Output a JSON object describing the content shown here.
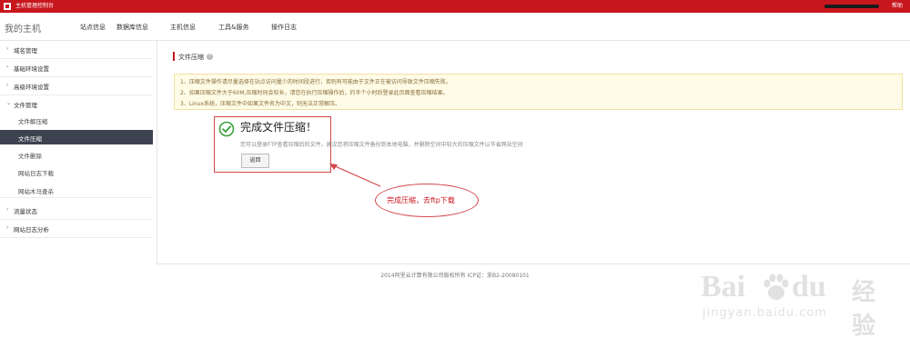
{
  "topbar": {
    "app_title": "主机管理控制台",
    "help_label": "帮助"
  },
  "navbar": {
    "brand": "我的主机",
    "items": [
      "站点信息",
      "数据库信息",
      "主机信息",
      "工具&服务",
      "操作日志"
    ]
  },
  "sidebar": {
    "group_caret": "›",
    "group_caret_open": "⌄",
    "groups_top": [
      "域名管理",
      "基础环境设置",
      "高级环境设置"
    ],
    "file_group": "文件管理",
    "file_items": [
      "文件解压缩",
      "文件压缩",
      "文件删除",
      "网站日志下载",
      "网站木马查杀"
    ],
    "groups_bottom": [
      "流量状态",
      "网站日志分析"
    ],
    "active_item": "文件压缩"
  },
  "panel": {
    "title": "文件压缩",
    "help_icon": "?",
    "notice": [
      "1、压缩文件操作请尽量选择在站点访问量少的时间段进行，否则有可能由于文件正在被访问导致文件压缩失败。",
      "2、如果压缩文件大于60M,压缩时间会较长，请您在执行压缩操作后，约半个小时后登录此页面查看压缩结果。",
      "3、Linux系统，压缩文件中如果文件名为中文，则无法正常解压。"
    ],
    "result_title": "完成文件压缩！",
    "result_desc": "您可以登录FTP查看压缩后的文件。建议您将压缩文件备份到本地电脑，并删除空间中较大的压缩文件以节省网站空间",
    "back_label": "返回"
  },
  "annotation": {
    "callout_text": "完成压缩，去ftp下载"
  },
  "footer": {
    "copyright": "2014阿里云计算有限公司版权所有 ICP证：浙B2-20080101"
  },
  "watermark": {
    "bai": "Bai",
    "du": "du",
    "jingyan": "经验",
    "url": "jingyan.baidu.com"
  },
  "colors": {
    "brand_red": "#c8161d",
    "active_nav_bg": "#3d4250",
    "success_green": "#3aa13a",
    "annotation_red": "#d3474b"
  },
  "icons": [
    "logo-icon",
    "help-icon",
    "check-circle-icon",
    "annotation-arrow",
    "baidu-paw-icon"
  ]
}
